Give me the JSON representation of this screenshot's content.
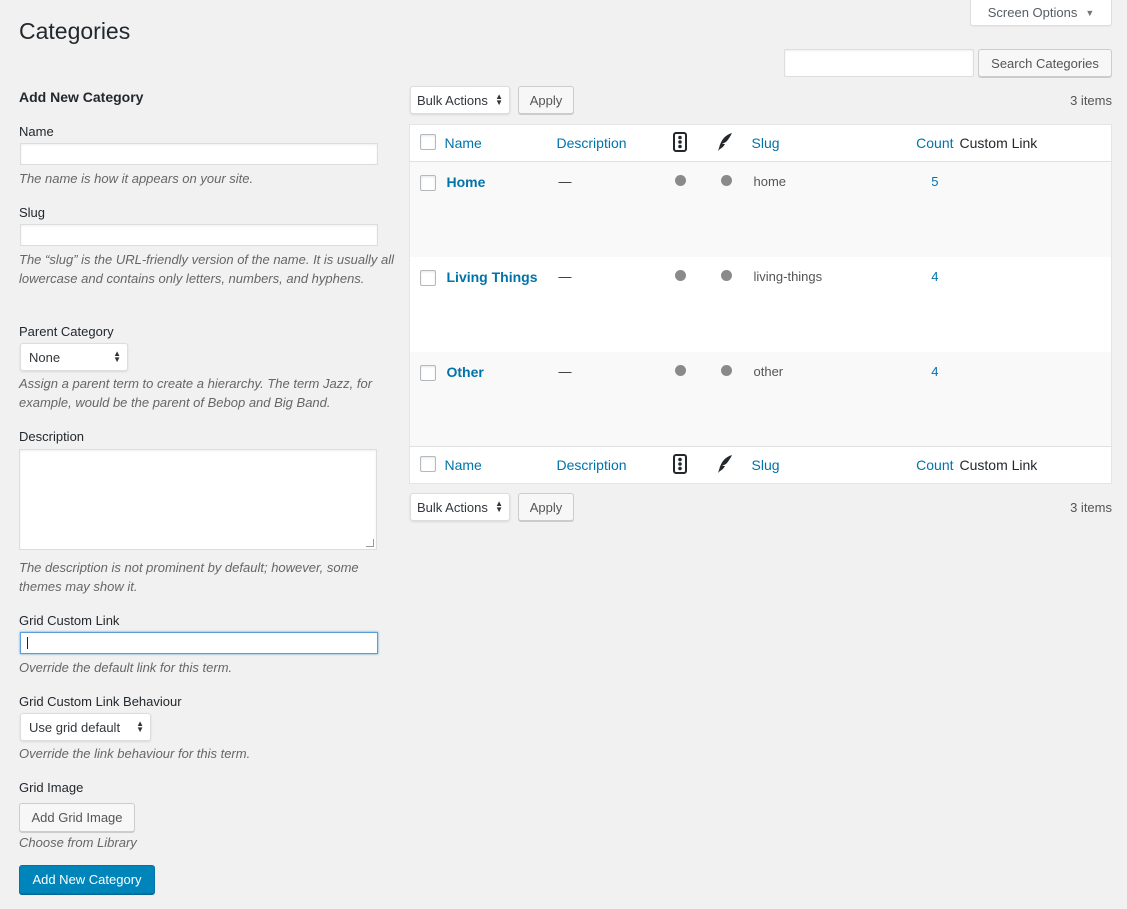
{
  "header": {
    "page_title": "Categories",
    "screen_options_label": "Screen Options",
    "search_button_label": "Search Categories",
    "search_value": ""
  },
  "form": {
    "title": "Add New Category",
    "name_label": "Name",
    "name_value": "",
    "name_help": "The name is how it appears on your site.",
    "slug_label": "Slug",
    "slug_value": "",
    "slug_help": "The “slug” is the URL-friendly version of the name. It is usually all lowercase and contains only letters, numbers, and hyphens.",
    "parent_label": "Parent Category",
    "parent_selected": "None",
    "parent_help": "Assign a parent term to create a hierarchy. The term Jazz, for example, would be the parent of Bebop and Big Band.",
    "description_label": "Description",
    "description_value": "",
    "description_help": "The description is not prominent by default; however, some themes may show it.",
    "grid_link_label": "Grid Custom Link",
    "grid_link_value": "",
    "grid_link_help": "Override the default link for this term.",
    "grid_behaviour_label": "Grid Custom Link Behaviour",
    "grid_behaviour_selected": "Use grid default",
    "grid_behaviour_help": "Override the link behaviour for this term.",
    "grid_image_label": "Grid Image",
    "add_grid_image_button": "Add Grid Image",
    "grid_image_help": "Choose from Library",
    "submit_button": "Add New Category"
  },
  "table": {
    "bulk_actions_label": "Bulk Actions",
    "apply_label": "Apply",
    "items_count": "3 items",
    "columns": {
      "name": "Name",
      "description": "Description",
      "slug": "Slug",
      "count": "Count",
      "custom_link": "Custom Link"
    },
    "rows": [
      {
        "name": "Home",
        "description": "—",
        "slug": "home",
        "count": "5",
        "custom_link": ""
      },
      {
        "name": "Living Things",
        "description": "—",
        "slug": "living-things",
        "count": "4",
        "custom_link": ""
      },
      {
        "name": "Other",
        "description": "—",
        "slug": "other",
        "count": "4",
        "custom_link": ""
      }
    ]
  },
  "icons": {
    "column_icon_1": "traffic-light-icon",
    "column_icon_2": "quill-feather-icon",
    "status_dot_color": "#8a8a8a"
  },
  "colors": {
    "link": "#0073aa",
    "primary_button": "#0085ba",
    "background": "#f1f1f1"
  }
}
